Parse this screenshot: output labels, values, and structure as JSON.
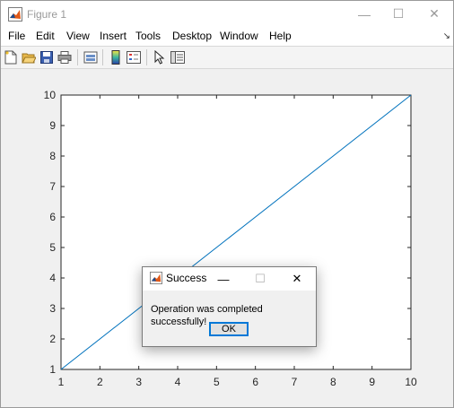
{
  "window": {
    "title": "Figure 1",
    "controls": {
      "minimize": "—",
      "maximize": "☐",
      "close": "✕"
    }
  },
  "menubar": {
    "items": [
      "File",
      "Edit",
      "View",
      "Insert",
      "Tools",
      "Desktop",
      "Window",
      "Help"
    ],
    "overflow": "↘"
  },
  "toolbar": {
    "buttons": [
      "new-figure-icon",
      "open-file-icon",
      "save-icon",
      "print-icon",
      "link-plot-icon",
      "insert-colorbar-icon",
      "insert-legend-icon",
      "edit-plot-icon",
      "property-inspector-icon"
    ]
  },
  "chart_data": {
    "type": "line",
    "x": [
      1,
      10
    ],
    "y": [
      1,
      10
    ],
    "xlim": [
      1,
      10
    ],
    "ylim": [
      1,
      10
    ],
    "xticks": [
      "1",
      "2",
      "3",
      "4",
      "5",
      "6",
      "7",
      "8",
      "9",
      "10"
    ],
    "yticks": [
      "1",
      "2",
      "3",
      "4",
      "5",
      "6",
      "7",
      "8",
      "9",
      "10"
    ],
    "title": "",
    "xlabel": "",
    "ylabel": "",
    "series": [
      {
        "color": "#0072bd"
      }
    ],
    "grid": false,
    "axes_color": "#262626"
  },
  "dialog": {
    "title": "Success",
    "message": "Operation was completed successfully!",
    "ok_label": "OK",
    "controls": {
      "minimize": "—",
      "maximize": "☐",
      "close": "✕"
    }
  }
}
